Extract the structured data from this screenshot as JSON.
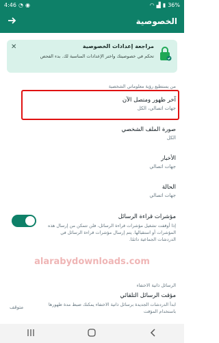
{
  "status_bar": {
    "time": "4:46",
    "battery": "36%"
  },
  "app_bar": {
    "title": "الخصوصية"
  },
  "banner": {
    "title": "مراجعة إعدادات الخصوصية",
    "text": "تحكم في خصوصيتك واختر الإعدادات المناسبة لك. بدء الفحص"
  },
  "sections": {
    "personal_info": "من يستطيع رؤية معلوماتي الشخصية",
    "disappearing": "الرسائل ذاتية الاختفاء"
  },
  "settings": {
    "last_seen": {
      "title": "آخر ظهور ومتصل الآن",
      "value": "جهات اتصالي، الكل"
    },
    "profile_photo": {
      "title": "صورة الملف الشخصي",
      "value": "الكل"
    },
    "about": {
      "title": "الأخبار",
      "value": "جهات اتصالي"
    },
    "status": {
      "title": "الحالة",
      "value": "جهات اتصالي"
    },
    "read_receipts": {
      "title": "مؤشرات قراءة الرسائل",
      "desc": "إذا أوقفت تشغيل مؤشرات قراءة الرسائل، فلن تتمكن من إرسال هذه المؤشرات أو استقبالها. يتم إرسال مؤشرات قراءة الرسائل في الدردشات الجماعية دائمًا.",
      "enabled": true
    },
    "default_timer": {
      "title": "مؤقت الرسائل التلقائي",
      "desc": "ابدأ الدردشات الجديدة برسائل ذاتية الاختفاء يمكنك ضبط مدة ظهورها باستخدام المؤقت",
      "value": "متوقف"
    }
  },
  "watermark": "alarabydownloads.com",
  "colors": {
    "primary": "#0e8068",
    "banner_bg": "#d9f2ea",
    "highlight": "#e01010"
  }
}
